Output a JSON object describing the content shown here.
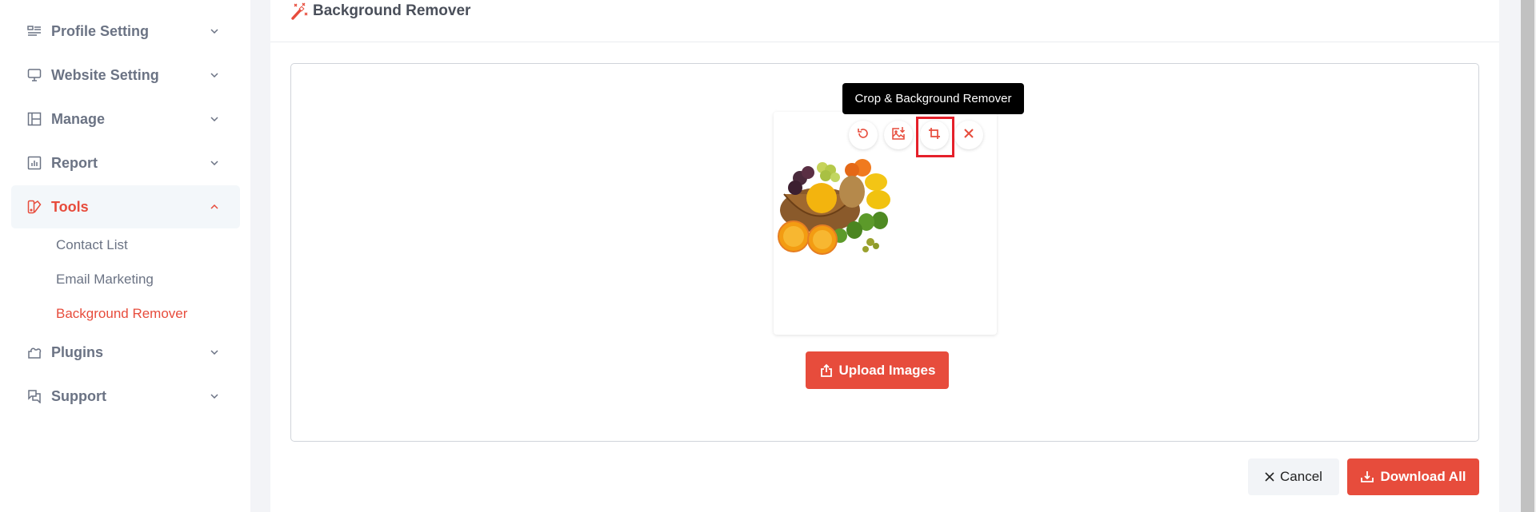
{
  "sidebar": {
    "items": [
      {
        "label": "Profile Setting",
        "icon": "profile-list-icon",
        "expanded": false
      },
      {
        "label": "Website Setting",
        "icon": "monitor-icon",
        "expanded": false
      },
      {
        "label": "Manage",
        "icon": "layout-icon",
        "expanded": false
      },
      {
        "label": "Report",
        "icon": "chart-icon",
        "expanded": false
      },
      {
        "label": "Tools",
        "icon": "tools-icon",
        "expanded": true,
        "active": true
      },
      {
        "label": "Plugins",
        "icon": "puzzle-icon",
        "expanded": false
      },
      {
        "label": "Support",
        "icon": "chat-icon",
        "expanded": false
      }
    ],
    "tools_sub": [
      {
        "label": "Contact List"
      },
      {
        "label": "Email Marketing"
      },
      {
        "label": "Background Remover",
        "active": true
      }
    ]
  },
  "card": {
    "title": "Background Remover",
    "title_icon": "magic-wand-icon"
  },
  "preview": {
    "image_alt": "Fruit basket",
    "actions": [
      {
        "name": "reset",
        "icon": "rotate-icon"
      },
      {
        "name": "replace-image",
        "icon": "image-download-icon"
      },
      {
        "name": "crop",
        "icon": "crop-icon",
        "highlighted": true
      },
      {
        "name": "remove",
        "icon": "close-icon"
      }
    ],
    "tooltip": "Crop & Background Remover"
  },
  "buttons": {
    "upload": "Upload Images",
    "cancel": "Cancel",
    "download": "Download All"
  },
  "colors": {
    "accent": "#e74c3c",
    "text_muted": "#6b7384",
    "highlight_border": "#e5202a"
  }
}
